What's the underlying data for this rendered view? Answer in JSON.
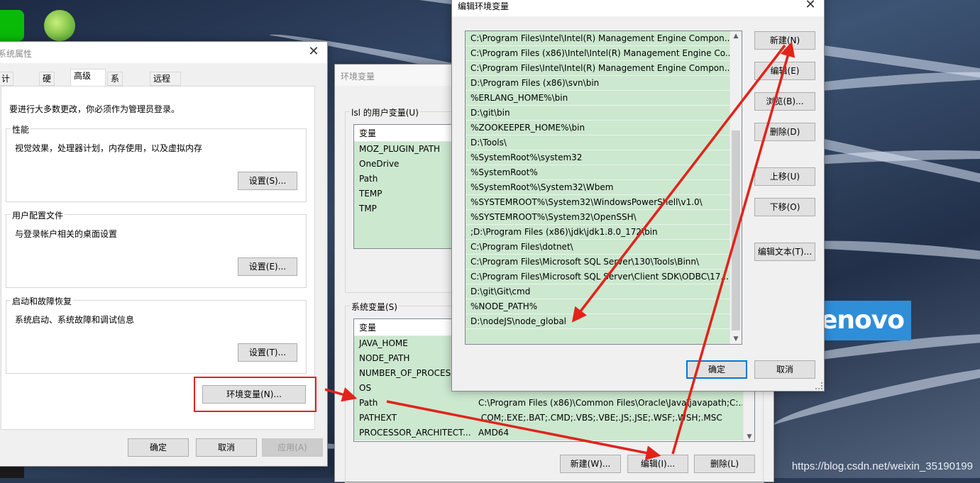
{
  "sysprops": {
    "title": "系统属性",
    "tabs": [
      "计算机名",
      "硬件",
      "高级",
      "系统保护",
      "远程"
    ],
    "admin_note": "要进行大多数更改，你必须作为管理员登录。",
    "perf": {
      "legend": "性能",
      "desc": "视觉效果，处理器计划，内存使用，以及虚拟内存",
      "button": "设置(S)..."
    },
    "profile": {
      "legend": "用户配置文件",
      "desc": "与登录帐户相关的桌面设置",
      "button": "设置(E)..."
    },
    "startup": {
      "legend": "启动和故障恢复",
      "desc": "系统启动、系统故障和调试信息",
      "button": "设置(T)..."
    },
    "env_button": "环境变量(N)...",
    "ok": "确定",
    "cancel": "取消",
    "apply": "应用(A)"
  },
  "envvars": {
    "title": "环境变量",
    "user_legend": "lsl 的用户变量(U)",
    "col_var": "变量",
    "user_vars": [
      "MOZ_PLUGIN_PATH",
      "OneDrive",
      "Path",
      "TEMP",
      "TMP"
    ],
    "sys_legend": "系统变量(S)",
    "sys_vars": [
      {
        "name": "JAVA_HOME",
        "value": ""
      },
      {
        "name": "NODE_PATH",
        "value": ""
      },
      {
        "name": "NUMBER_OF_PROCESS",
        "value": ""
      },
      {
        "name": "OS",
        "value": ""
      },
      {
        "name": "Path",
        "value": "C:\\Program Files (x86)\\Common Files\\Oracle\\Java\\javapath;C:..."
      },
      {
        "name": "PATHEXT",
        "value": ".COM;.EXE;.BAT;.CMD;.VBS;.VBE;.JS;.JSE;.WSF;.WSH;.MSC"
      },
      {
        "name": "PROCESSOR_ARCHITECT...",
        "value": "AMD64"
      }
    ],
    "new": "新建(W)...",
    "edit": "编辑(I)...",
    "delete": "删除(L)"
  },
  "editenv": {
    "title": "编辑环境变量",
    "paths": [
      "C:\\Program Files\\Intel\\Intel(R) Management Engine Compon...",
      "C:\\Program Files (x86)\\Intel\\Intel(R) Management Engine Co...",
      "C:\\Program Files\\Intel\\Intel(R) Management Engine Compon...",
      "D:\\Program Files (x86)\\svn\\bin",
      "%ERLANG_HOME%\\bin",
      "D:\\git\\bin",
      "%ZOOKEEPER_HOME%\\bin",
      "D:\\Tools\\",
      "%SystemRoot%\\system32",
      "%SystemRoot%",
      "%SystemRoot%\\System32\\Wbem",
      "%SYSTEMROOT%\\System32\\WindowsPowerShell\\v1.0\\",
      "%SYSTEMROOT%\\System32\\OpenSSH\\",
      ";D:\\Program Files (x86)\\jdk\\jdk1.8.0_172\\bin",
      "C:\\Program Files\\dotnet\\",
      "C:\\Program Files\\Microsoft SQL Server\\130\\Tools\\Binn\\",
      "C:\\Program Files\\Microsoft SQL Server\\Client SDK\\ODBC\\17...",
      "D:\\git\\Git\\cmd",
      "%NODE_PATH%",
      "D:\\nodeJS\\node_global"
    ],
    "new": "新建(N)",
    "edit": "编辑(E)",
    "browse": "浏览(B)...",
    "delete": "删除(D)",
    "up": "上移(U)",
    "down": "下移(O)",
    "edit_text": "编辑文本(T)...",
    "ok": "确定",
    "cancel": "取消"
  },
  "desktop": {
    "brand": "enovo",
    "watermark": "https://blog.csdn.net/weixin_35190199"
  },
  "colors": {
    "annotation": "#e2231a",
    "selection": "#cce8cf",
    "focus": "#0078d7"
  }
}
